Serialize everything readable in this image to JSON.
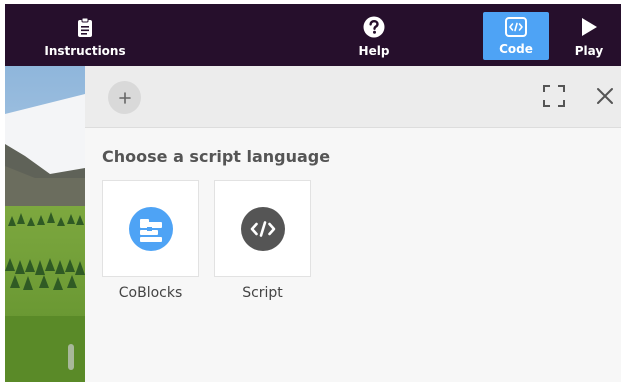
{
  "topbar": {
    "background": "#260f2c",
    "instructions": {
      "label": "Instructions",
      "icon": "clipboard-icon"
    },
    "help": {
      "label": "Help",
      "icon": "question-circle-icon"
    },
    "code": {
      "label": "Code",
      "icon": "code-brackets-icon",
      "active": true,
      "active_color": "#4ea3f5"
    },
    "play": {
      "label": "Play",
      "icon": "play-icon"
    }
  },
  "panel": {
    "header": {
      "add_icon": "plus-icon",
      "expand_icon": "expand-icon",
      "close_icon": "close-icon"
    },
    "title": "Choose a script language",
    "options": [
      {
        "label": "CoBlocks",
        "icon": "coblocks-icon",
        "color": "#4ea3f5"
      },
      {
        "label": "Script",
        "icon": "code-brackets-icon",
        "color": "#555555"
      }
    ]
  }
}
